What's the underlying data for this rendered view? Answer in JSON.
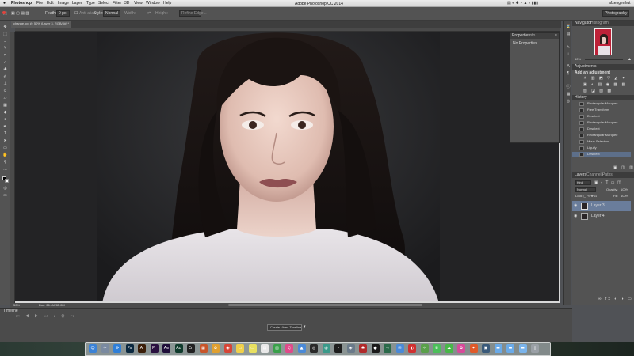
{
  "menubar": {
    "apple": "",
    "app_name": "Photoshop",
    "menus": [
      "File",
      "Edit",
      "Image",
      "Layer",
      "Type",
      "Select",
      "Filter",
      "3D",
      "View",
      "Window",
      "Help"
    ],
    "user": "afxengenhut"
  },
  "window_title": "Adobe Photoshop CC 2014",
  "options_bar": {
    "feather_label": "Feather:",
    "feather_value": "0 px",
    "antialias_label": "Anti-alias",
    "style_label": "Style:",
    "style_value": "Normal",
    "width_label": "Width:",
    "height_label": "Height:",
    "refine_edge": "Refine Edge...",
    "workspace": "Photography"
  },
  "document_tab": "change.jpg @ 50% (Layer 3, RGB/8#) *",
  "properties_panel": {
    "tabs": [
      "Properties",
      "Info"
    ],
    "empty_text": "No Properties"
  },
  "navigator_panel": {
    "tabs": [
      "Navigator",
      "Histogram"
    ],
    "zoom": "50%"
  },
  "adjustments_panel": {
    "tab": "Adjustments",
    "title": "Add an adjustment"
  },
  "history_panel": {
    "tab": "History",
    "items": [
      "Rectangular Marquee",
      "Free Transform",
      "Deselect",
      "Rectangular Marquee",
      "Deselect",
      "Rectangular Marquee",
      "Move Selection",
      "Liquify",
      "Deselect"
    ],
    "selected_index": 8
  },
  "layers_panel": {
    "tabs": [
      "Layers",
      "Channels",
      "Paths"
    ],
    "kind_label": "Kind",
    "blend_mode": "Normal",
    "opacity_label": "Opacity:",
    "opacity_value": "100%",
    "lock_label": "Lock:",
    "fill_label": "Fill:",
    "fill_value": "100%",
    "layers": [
      {
        "name": "Layer 3",
        "selected": true
      },
      {
        "name": "Layer 4",
        "selected": false
      }
    ]
  },
  "status_bar": {
    "zoom": "50%",
    "doc_size": "Doc: 26.4M/85.0M"
  },
  "timeline_panel": {
    "tab": "Timeline",
    "create_button": "Create Video Timeline"
  },
  "dock": {
    "apps": [
      {
        "icon": "finder-icon",
        "glyph": "☺",
        "color": "#3b82d6"
      },
      {
        "icon": "launchpad-icon",
        "glyph": "✈",
        "color": "#7a8aa0"
      },
      {
        "icon": "safari-icon",
        "glyph": "✣",
        "color": "#2f7fd8"
      },
      {
        "icon": "photoshop-icon",
        "glyph": "Ps",
        "color": "#0b2940"
      },
      {
        "icon": "illustrator-icon",
        "glyph": "Ai",
        "color": "#3b1e08"
      },
      {
        "icon": "premiere-icon",
        "glyph": "Pr",
        "color": "#2a1140"
      },
      {
        "icon": "after-effects-icon",
        "glyph": "Ae",
        "color": "#1f0e3a"
      },
      {
        "icon": "audition-icon",
        "glyph": "Au",
        "color": "#0f3b2c"
      },
      {
        "icon": "encore-icon",
        "glyph": "En",
        "color": "#222"
      },
      {
        "icon": "toolbox-icon",
        "glyph": "▦",
        "color": "#c8552a"
      },
      {
        "icon": "photos-icon",
        "glyph": "✿",
        "color": "#e0a030"
      },
      {
        "icon": "chrome-icon",
        "glyph": "◉",
        "color": "#d64537"
      },
      {
        "icon": "notes-icon",
        "glyph": "▭",
        "color": "#f0d04a"
      },
      {
        "icon": "stickies-icon",
        "glyph": "▭",
        "color": "#e8e060"
      },
      {
        "icon": "calendar-icon",
        "glyph": "▤",
        "color": "#e8e8e8"
      },
      {
        "icon": "numbers-icon",
        "glyph": "▥",
        "color": "#39a04a"
      },
      {
        "icon": "itunes-icon",
        "glyph": "♫",
        "color": "#e04a8a"
      },
      {
        "icon": "keynote-icon",
        "glyph": "▲",
        "color": "#4a8ad8"
      },
      {
        "icon": "activity-icon",
        "glyph": "◎",
        "color": "#2a2a2a"
      },
      {
        "icon": "utility-icon",
        "glyph": "◍",
        "color": "#3a9a8a"
      },
      {
        "icon": "terminal-icon",
        "glyph": "›",
        "color": "#1e1e1e"
      },
      {
        "icon": "preview-icon",
        "glyph": "◈",
        "color": "#6a7a8a"
      },
      {
        "icon": "game-icon",
        "glyph": "♣",
        "color": "#b02a2a"
      },
      {
        "icon": "spotify-icon",
        "glyph": "●",
        "color": "#1a1a1a"
      },
      {
        "icon": "activity-monitor-icon",
        "glyph": "∿",
        "color": "#2a6a4a"
      },
      {
        "icon": "mail-icon",
        "glyph": "✉",
        "color": "#4a8ad8"
      },
      {
        "icon": "chrome-red-icon",
        "glyph": "◐",
        "color": "#d03030"
      },
      {
        "icon": "maps-icon",
        "glyph": "✧",
        "color": "#5aa04a"
      },
      {
        "icon": "messages-icon",
        "glyph": "✆",
        "color": "#4cbf5a"
      },
      {
        "icon": "wechat-icon",
        "glyph": "☁",
        "color": "#48b848"
      },
      {
        "icon": "flower-icon",
        "glyph": "✿",
        "color": "#d84a9a"
      },
      {
        "icon": "rocket-icon",
        "glyph": "✦",
        "color": "#e05a2a"
      },
      {
        "icon": "screen-icon",
        "glyph": "▣",
        "color": "#3a5a7a"
      },
      {
        "icon": "folder-icon",
        "glyph": "▬",
        "color": "#6aaae8"
      },
      {
        "icon": "folder2-icon",
        "glyph": "▬",
        "color": "#6aaae8"
      },
      {
        "icon": "folder3-icon",
        "glyph": "▬",
        "color": "#7ab4ec"
      },
      {
        "icon": "trash-icon",
        "glyph": "▯",
        "color": "#9aa0a6"
      }
    ]
  }
}
